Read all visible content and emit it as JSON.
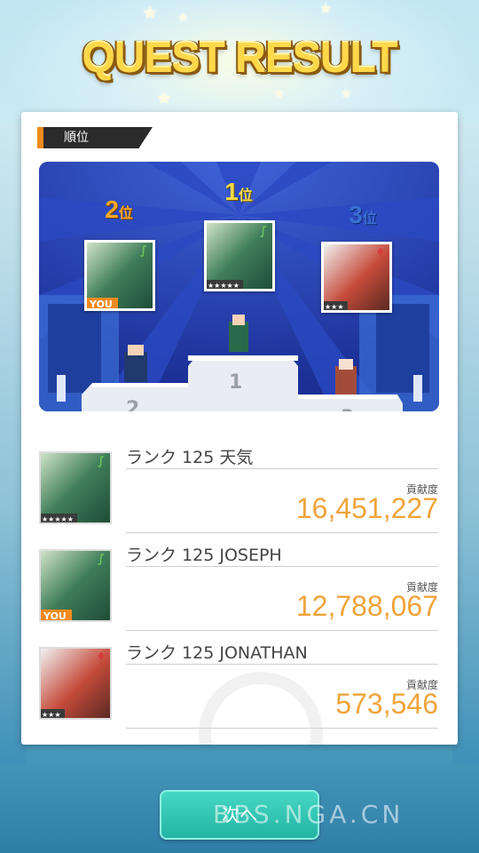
{
  "title": "QUEST RESULT",
  "section_label": "順位",
  "podium": {
    "first": {
      "num": "1",
      "suffix": "位",
      "stars": "★★★★★"
    },
    "second": {
      "num": "2",
      "suffix": "位",
      "tag": "YOU"
    },
    "third": {
      "num": "3",
      "suffix": "位",
      "stars": "★★★"
    },
    "step_labels": [
      "1",
      "2",
      "3"
    ]
  },
  "results": [
    {
      "name": "ランク 125 天気",
      "contrib_label": "貢献度",
      "value": "16,451,227",
      "tag": "★★★★★",
      "is_you": false,
      "element": "wind"
    },
    {
      "name": "ランク 125 JOSEPH",
      "contrib_label": "貢献度",
      "value": "12,788,067",
      "tag": "YOU",
      "is_you": true,
      "element": "wind"
    },
    {
      "name": "ランク 125 JONATHAN",
      "contrib_label": "貢献度",
      "value": "573,546",
      "tag": "★★★",
      "is_you": false,
      "element": "fire"
    }
  ],
  "next_button": "次へ",
  "watermark": "BBS.NGA.CN",
  "colors": {
    "accent_orange": "#f08a1e",
    "value_orange": "#f0a43a",
    "button_teal": "#2cc2b0",
    "title_gold": "#ffd84a",
    "rank1": "#f5d84a",
    "rank2": "#f4a81e",
    "rank3": "#3b6fd4"
  }
}
